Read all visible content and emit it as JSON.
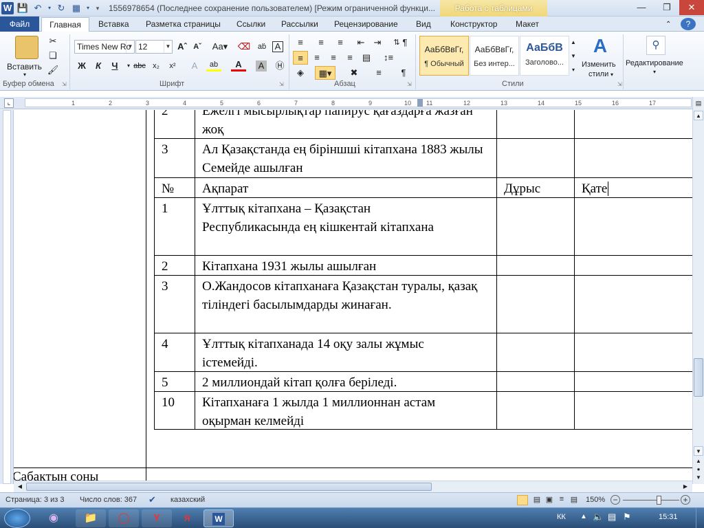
{
  "titlebar": {
    "doc_title": "1556978654 (Последнее сохранение пользователем) [Режим ограниченной функци...",
    "context_group": "Работа с таблицами"
  },
  "tabs": {
    "file": "Файл",
    "items": [
      "Главная",
      "Вставка",
      "Разметка страницы",
      "Ссылки",
      "Рассылки",
      "Рецензирование",
      "Вид",
      "Конструктор",
      "Макет"
    ]
  },
  "ribbon": {
    "clipboard": {
      "paste_label": "Вставить",
      "group_label": "Буфер обмена"
    },
    "font": {
      "family": "Times New Ro",
      "size": "12",
      "group_label": "Шрифт"
    },
    "paragraph": {
      "group_label": "Абзац"
    },
    "styles": {
      "group_label": "Стили",
      "items": [
        {
          "preview": "АаБбВвГг,",
          "name": "¶ Обычный"
        },
        {
          "preview": "АаБбВвГг,",
          "name": "Без интер..."
        },
        {
          "preview": "АаБбВ",
          "name": "Заголово..."
        }
      ],
      "change_styles_label_1": "Изменить",
      "change_styles_label_2": "стили"
    },
    "editing": {
      "label": "Редактирование"
    }
  },
  "ruler": {
    "numbers": [
      "1",
      "2",
      "3",
      "4",
      "5",
      "6",
      "7",
      "8",
      "9",
      "10",
      "11",
      "12",
      "13",
      "14",
      "15",
      "16",
      "17"
    ]
  },
  "document": {
    "top_rows": [
      {
        "num": "2",
        "text": "Ежелгі мысырлықтар  папирус қағаздарға  жазған жоқ"
      },
      {
        "num": "3",
        "text": "Ал   Қазақстанда ең біріншші  кітапхана 1883 жылы Семейде ашылған"
      }
    ],
    "header": {
      "num": "№",
      "info": "Ақпарат",
      "true": "Дұрыс",
      "false": "Қате"
    },
    "rows": [
      {
        "num": "1",
        "text": "Ұлттық  кітапхана – Қазақстан Республикасында  ең кішкентай кітапхана"
      },
      {
        "num": "2",
        "text": "Кітапхана  1931 жылы  ашылған"
      },
      {
        "num": "3",
        "text": "О.Жандосов кітапханаға Қазақстан туралы,  қазақ тіліндегі басылымдарды жинаған."
      },
      {
        "num": "4",
        "text": "Ұлттық  кітапханада  14 оқу залы жұмыс істемейді."
      },
      {
        "num": "5",
        "text": "2 миллиондай кітап қолға беріледі."
      },
      {
        "num": "10",
        "text": "Кітапханаға 1 жылда 1 миллионнан астам  оқырман келмейді"
      }
    ],
    "lesson_end": "Сабақтың соңы"
  },
  "statusbar": {
    "page": "Страница: 3 из 3",
    "words": "Число слов: 367",
    "language": "казахский",
    "zoom": "150%"
  },
  "taskbar": {
    "lang": "КК",
    "time": "15:31"
  }
}
